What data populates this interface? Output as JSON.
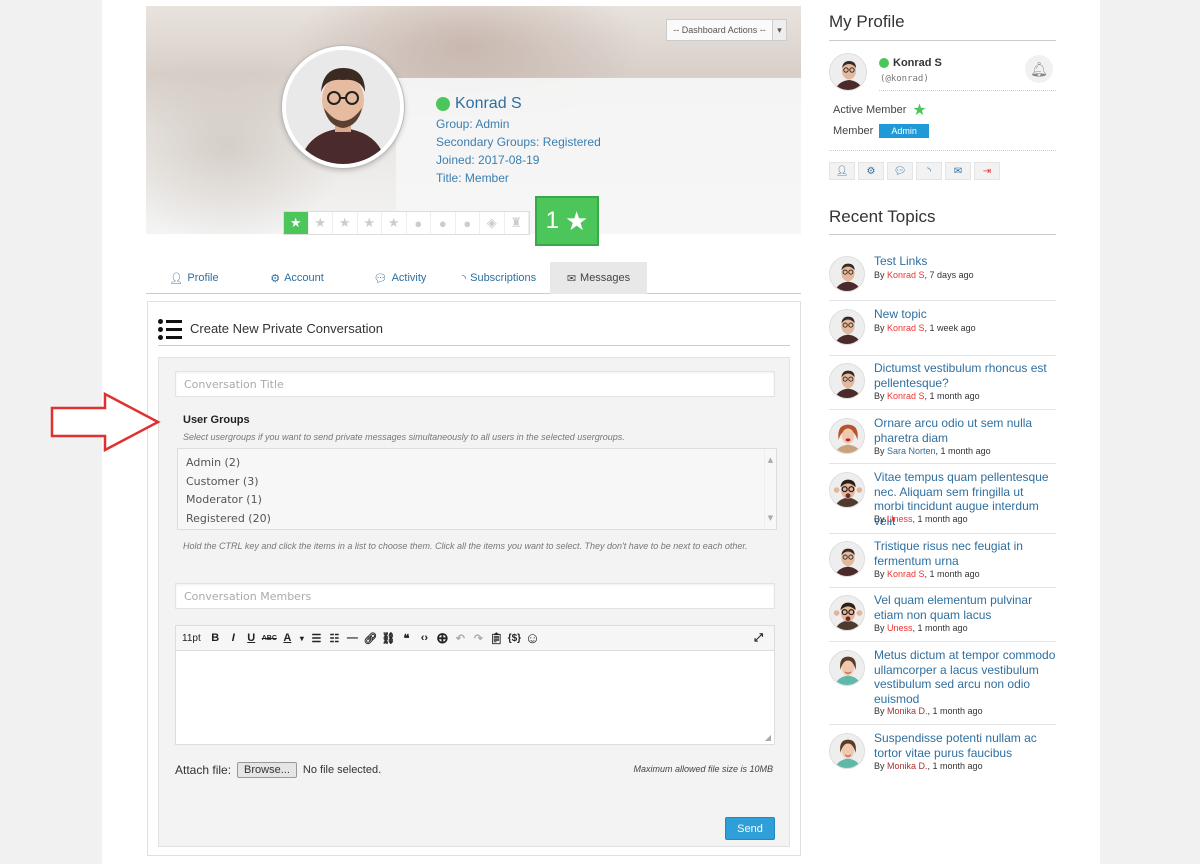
{
  "dashboard_actions": "-- Dashboard Actions --",
  "profile": {
    "name": "Konrad S",
    "group": "Group: Admin",
    "secondary_groups": "Secondary Groups: Registered",
    "joined": "Joined: 2017-08-19",
    "title": "Title: Member",
    "rank_level": "1",
    "rank_stars_filled": 1,
    "rank_slots": 10
  },
  "tabs": [
    {
      "label": "Profile",
      "icon": "user-icon"
    },
    {
      "label": "Account",
      "icon": "gear-icon"
    },
    {
      "label": "Activity",
      "icon": "comments-icon"
    },
    {
      "label": "Subscriptions",
      "icon": "rss-icon"
    },
    {
      "label": "Messages",
      "icon": "envelope-icon",
      "active": true
    }
  ],
  "form": {
    "heading": "Create New Private Conversation",
    "title_placeholder": "Conversation Title",
    "user_groups_label": "User Groups",
    "user_groups_help": "Select usergroups if you want to send private messages simultaneously to all users in the selected usergroups.",
    "user_groups": [
      "Admin (2)",
      "Customer (3)",
      "Moderator (1)",
      "Registered (20)"
    ],
    "ctrl_help": "Hold the CTRL key and click the items in a list to choose them. Click all the items you want to select. They don't have to be next to each other.",
    "members_placeholder": "Conversation Members",
    "font_size": "11pt",
    "attach_label": "Attach file:",
    "browse_label": "Browse...",
    "no_file": "No file selected.",
    "max_size": "Maximum allowed file size is 10MB",
    "send_label": "Send"
  },
  "sidebar": {
    "my_profile_heading": "My Profile",
    "user_name": "Konrad S",
    "user_handle": "(@konrad)",
    "active_member": "Active Member",
    "member_label": "Member",
    "member_badge": "Admin",
    "recent_topics_heading": "Recent Topics",
    "topics": [
      {
        "title": "Test Links",
        "by": "By ",
        "author": "Konrad S",
        "time": ", 7 days ago"
      },
      {
        "title": "New topic",
        "by": "By ",
        "author": "Konrad S",
        "time": ", 1 week ago"
      },
      {
        "title": "Dictumst vestibulum rhoncus est pellentesque?",
        "by": "By ",
        "author": "Konrad S",
        "time": ", 1 month ago"
      },
      {
        "title": "Ornare arcu odio ut sem nulla pharetra diam",
        "by": "By ",
        "author": "Sara Norten",
        "time": ", 1 month ago"
      },
      {
        "title": "Vitae tempus quam pellentesque nec. Aliquam sem fringilla ut morbi tincidunt augue interdum velit",
        "by": "By ",
        "author": "Uness",
        "time": ", 1 month ago"
      },
      {
        "title": "Tristique risus nec feugiat in fermentum urna",
        "by": "By ",
        "author": "Konrad S",
        "time": ", 1 month ago"
      },
      {
        "title": "Vel quam elementum pulvinar etiam non quam lacus",
        "by": "By ",
        "author": "Uness",
        "time": ", 1 month ago"
      },
      {
        "title": "Metus dictum at tempor commodo ullamcorper a lacus vestibulum vestibulum sed arcu non odio euismod",
        "by": "By ",
        "author": "Monika D.",
        "time": ", 1 month ago"
      },
      {
        "title": "Suspendisse potenti nullam ac tortor vitae purus faucibus",
        "by": "By ",
        "author": "Monika D.",
        "time": ", 1 month ago"
      }
    ]
  },
  "colors": {
    "accent": "#2f6f9f",
    "online": "#4cc65b",
    "send": "#2e9fd8",
    "author_red": "#e33333"
  }
}
